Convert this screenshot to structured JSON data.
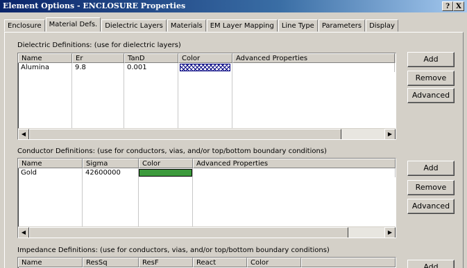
{
  "window": {
    "title": "Element Options - ENCLOSURE Properties",
    "help_label": "?",
    "close_label": "X"
  },
  "tabs": [
    "Enclosure",
    "Material Defs.",
    "Dielectric Layers",
    "Materials",
    "EM Layer Mapping",
    "Line Type",
    "Parameters",
    "Display"
  ],
  "active_tab": "Material Defs.",
  "dielectric": {
    "label": "Dielectric Definitions: (use for dielectric layers)",
    "columns": [
      "Name",
      "Er",
      "TanD",
      "Color",
      "Advanced Properties"
    ],
    "rows": [
      {
        "name": "Alumina",
        "er": "9.8",
        "tand": "0.001",
        "color": "hatched-blue"
      }
    ],
    "buttons": {
      "add": "Add",
      "remove": "Remove",
      "advanced": "Advanced"
    }
  },
  "conductor": {
    "label": "Conductor  Definitions: (use for conductors, vias, and/or top/bottom boundary conditions)",
    "columns": [
      "Name",
      "Sigma",
      "Color",
      "Advanced Properties"
    ],
    "rows": [
      {
        "name": "Gold",
        "sigma": "42600000",
        "color": "#3c9a3c"
      }
    ],
    "buttons": {
      "add": "Add",
      "remove": "Remove",
      "advanced": "Advanced"
    }
  },
  "impedance": {
    "label": "Impedance  Definitions: (use for conductors, vias, and/or top/bottom boundary conditions)",
    "columns": [
      "Name",
      "ResSq",
      "ResF",
      "React",
      "Color"
    ],
    "buttons": {
      "add": "Add"
    }
  },
  "scroll_icons": {
    "left": "left-arrow-icon",
    "right": "right-arrow-icon"
  },
  "colors": {
    "chrome": "#d4d0c8",
    "title_start": "#0a246a",
    "gold_swatch": "#3c9a3c",
    "hatch": "#000080"
  }
}
